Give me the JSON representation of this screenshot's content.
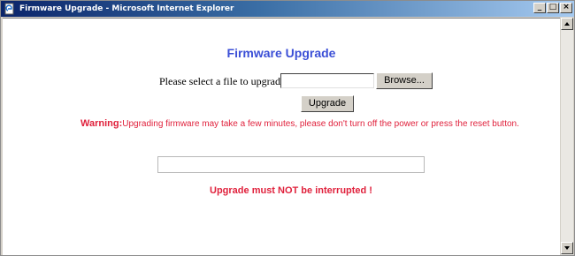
{
  "window": {
    "title": "Firmware Upgrade - Microsoft Internet Explorer",
    "buttons": {
      "minimize": "_",
      "maximize": "□",
      "close": "×"
    }
  },
  "page": {
    "heading": "Firmware Upgrade",
    "file_label": "Please select a file to upgrade:",
    "file_input": {
      "value": "",
      "placeholder": ""
    },
    "browse_label": "Browse...",
    "upgrade_label": "Upgrade",
    "warning": {
      "prefix": "Warning:",
      "text": "Upgrading firmware may take a few minutes, please don't turn off the power or press the reset button."
    },
    "progress": {
      "fraction": 0
    },
    "interrupt_note": "Upgrade must NOT be interrupted !"
  },
  "colors": {
    "heading": "#3b4fd6",
    "warning": "#e0213c",
    "titlebar_start": "#0a246a",
    "titlebar_end": "#a6caf0"
  },
  "icons": {
    "title": "ie-page-icon",
    "scroll_up": "scroll-up-arrow-icon",
    "scroll_down": "scroll-down-arrow-icon"
  }
}
